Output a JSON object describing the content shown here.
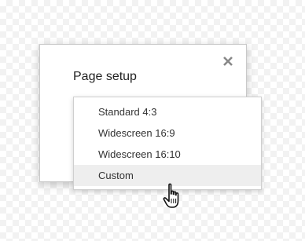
{
  "dialog": {
    "title": "Page setup",
    "close_icon": "close-icon"
  },
  "dropdown": {
    "items": [
      {
        "label": "Standard 4:3",
        "active": false
      },
      {
        "label": "Widescreen 16:9",
        "active": false
      },
      {
        "label": "Widescreen 16:10",
        "active": false
      },
      {
        "label": "Custom",
        "active": true
      }
    ]
  },
  "pointer": {
    "icon": "hand-pointer-icon"
  },
  "colors": {
    "hover_bg": "#eeeeee",
    "text": "#333333",
    "close": "#888888"
  }
}
